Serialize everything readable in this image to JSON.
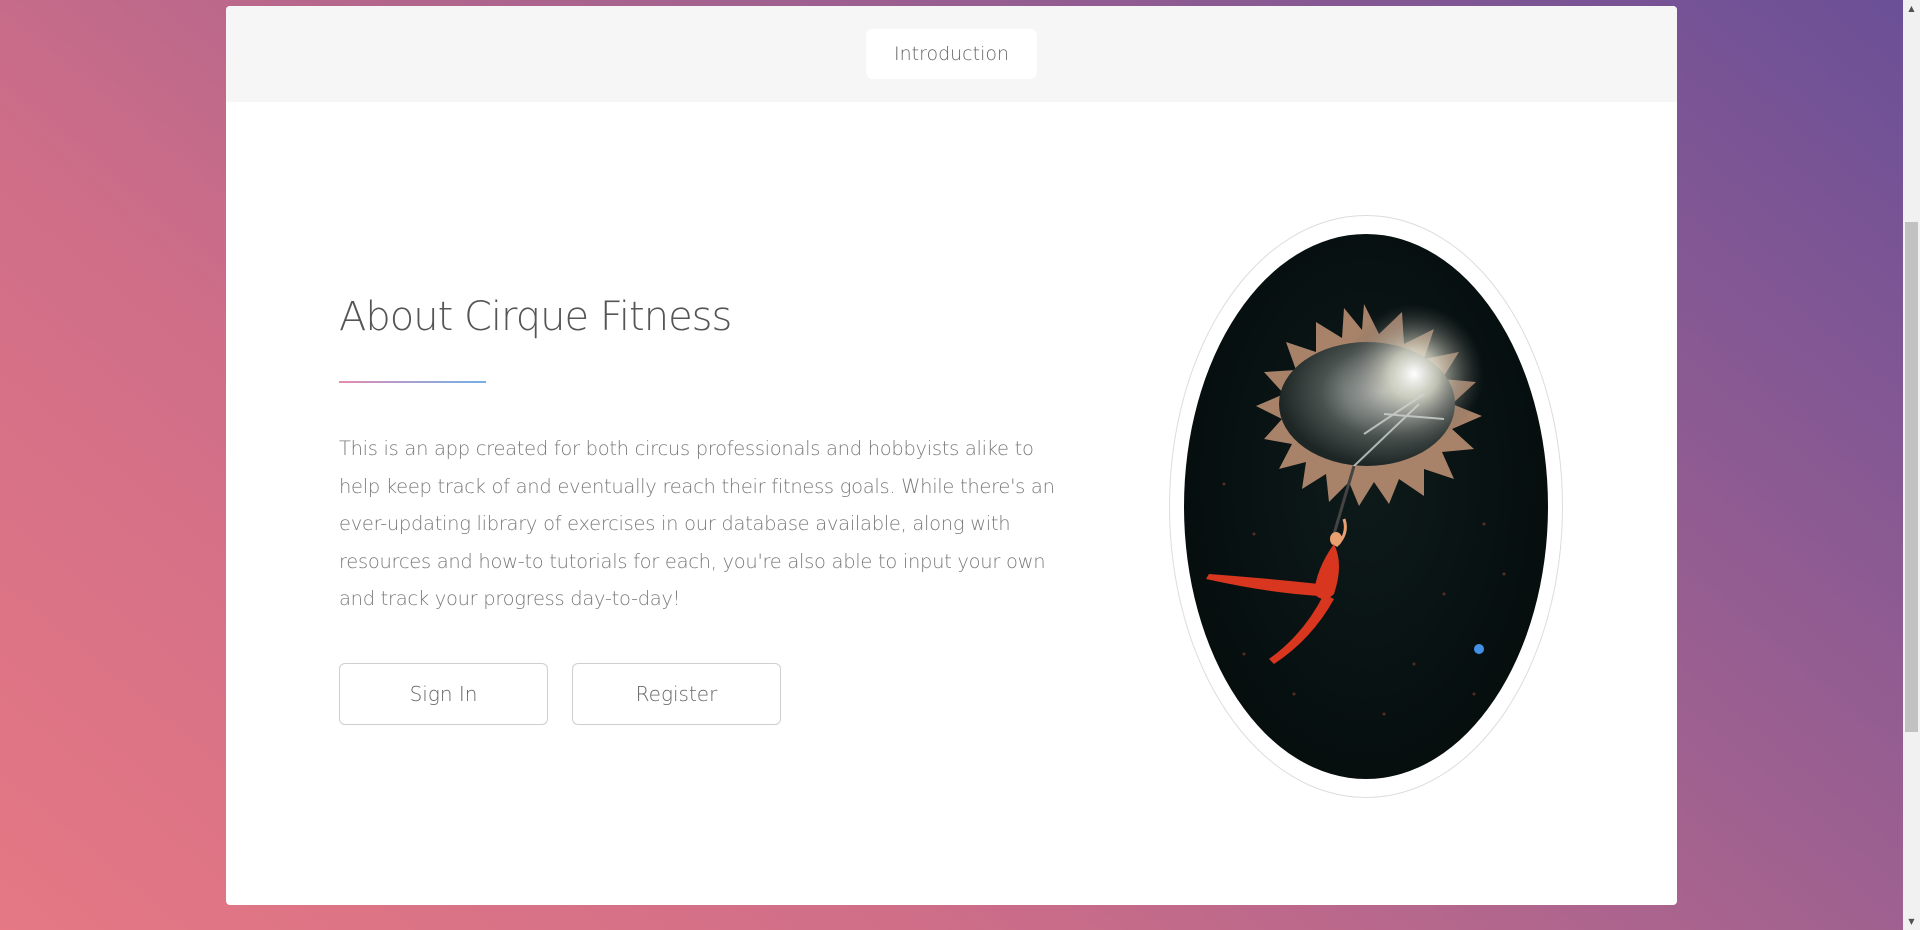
{
  "header": {
    "tab_label": "Introduction"
  },
  "about": {
    "title": "About Cirque Fitness",
    "description": "This is an app created for both circus professionals and hobbyists alike to help keep track of and eventually reach their fitness goals. While there's an ever-updating library of exercises in our database available, along with resources and how-to tutorials for each, you're also able to input your own and track your progress day-to-day!",
    "signin_label": "Sign In",
    "register_label": "Register"
  },
  "image": {
    "subject": "aerial acrobat under circus tent"
  },
  "colors": {
    "bg_start": "#e57884",
    "bg_end": "#6a4f97",
    "divider_start": "#e58bb0",
    "divider_end": "#73b0e6"
  },
  "scrollbar": {
    "up_icon": "scroll-up-arrow",
    "down_icon": "scroll-down-arrow"
  }
}
